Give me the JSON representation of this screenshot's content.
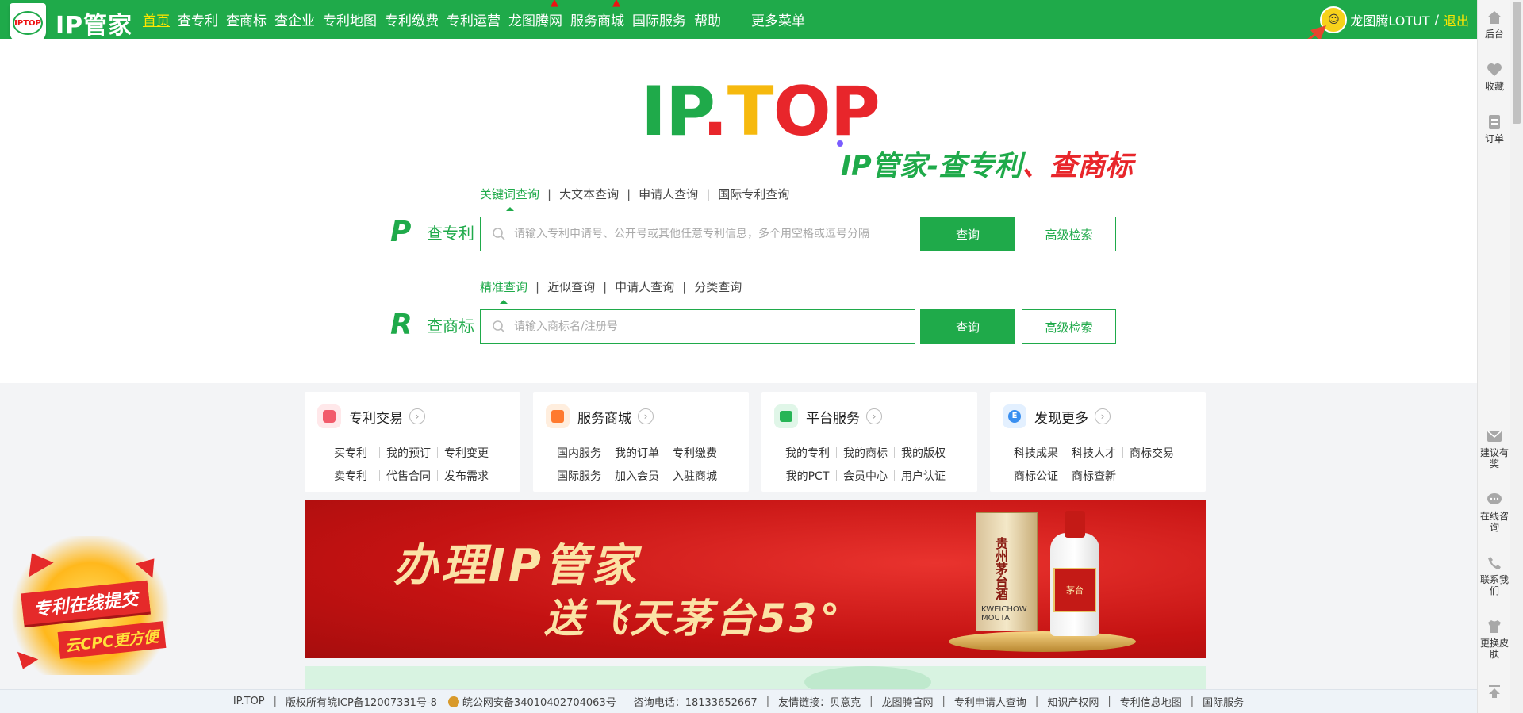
{
  "header": {
    "logo_text": "IPTOP",
    "brand": "IP管家",
    "nav": [
      {
        "label": "首页",
        "active": true
      },
      {
        "label": "查专利"
      },
      {
        "label": "查商标"
      },
      {
        "label": "查企业"
      },
      {
        "label": "专利地图"
      },
      {
        "label": "专利缴费"
      },
      {
        "label": "专利运营"
      },
      {
        "label": "龙图腾网",
        "hot": true
      },
      {
        "label": "服务商城",
        "hot": true
      },
      {
        "label": "国际服务"
      },
      {
        "label": "帮助"
      }
    ],
    "more_menu": "更多菜单",
    "username": "龙图腾LOTUT",
    "separator": "/",
    "logout": "退出"
  },
  "hero": {
    "logo_ip": "IP",
    "logo_dot": ".",
    "logo_t": "T",
    "logo_op": "OP",
    "slogan_main": "IP管家-查专利",
    "slogan_sep": "、",
    "slogan_red": "查商标"
  },
  "patent_search": {
    "tabs": [
      "关键词查询",
      "大文本查询",
      "申请人查询",
      "国际专利查询"
    ],
    "letter": "P",
    "label": "查专利",
    "placeholder": "请输入专利申请号、公开号或其他任意专利信息，多个用空格或逗号分隔",
    "search_button": "查询",
    "advanced_button": "高级检索"
  },
  "trademark_search": {
    "tabs": [
      "精准查询",
      "近似查询",
      "申请人查询",
      "分类查询"
    ],
    "letter": "R",
    "label": "查商标",
    "placeholder": "请输入商标名/注册号",
    "search_button": "查询",
    "advanced_button": "高级检索"
  },
  "cards": [
    {
      "title": "专利交易",
      "icon": "patent-trade-icon",
      "color": "#f25b6b",
      "bg": "#ffe8ea",
      "links": [
        [
          "买专利",
          "我的预订",
          "专利变更"
        ],
        [
          "卖专利",
          "代售合同",
          "发布需求"
        ]
      ]
    },
    {
      "title": "服务商城",
      "icon": "mall-icon",
      "color": "#ff7a2f",
      "bg": "#ffeede",
      "links": [
        [
          "国内服务",
          "我的订单",
          "专利缴费"
        ],
        [
          "国际服务",
          "加入会员",
          "入驻商城"
        ]
      ]
    },
    {
      "title": "平台服务",
      "icon": "platform-icon",
      "color": "#27b556",
      "bg": "#e0f6e8",
      "links": [
        [
          "我的专利",
          "我的商标",
          "我的版权"
        ],
        [
          "我的PCT",
          "会员中心",
          "用户认证"
        ]
      ]
    },
    {
      "title": "发现更多",
      "icon": "discover-icon",
      "color": "#3a8ff0",
      "bg": "#e3f0ff",
      "links": [
        [
          "科技成果",
          "科技人才",
          "商标交易"
        ],
        [
          "商标公证",
          "商标查新"
        ]
      ]
    }
  ],
  "banner": {
    "line1": "办理IP管家",
    "line2": "送飞天茅台53°",
    "box_text": "贵州茅台酒",
    "box_sub": "KWEICHOW MOUTAI"
  },
  "promo": {
    "line1": "专利在线提交",
    "line2": "云CPC更方便"
  },
  "footer": {
    "items": [
      "IP.TOP",
      "版权所有皖ICP备12007331号-8",
      "皖公网安备34010402704063号",
      "咨询电话：18133652667",
      "友情链接：贝意克",
      "龙图腾官网",
      "专利申请人查询",
      "知识产权网",
      "专利信息地图",
      "国际服务"
    ]
  },
  "sidebar": {
    "items": [
      {
        "label": "后台",
        "icon": "home-icon"
      },
      {
        "label": "收藏",
        "icon": "heart-icon"
      },
      {
        "label": "订单",
        "icon": "order-icon"
      },
      {
        "label": "建议有奖",
        "icon": "suggestion-icon"
      },
      {
        "label": "在线咨询",
        "icon": "chat-icon"
      },
      {
        "label": "联系我们",
        "icon": "phone-icon"
      },
      {
        "label": "更换皮肤",
        "icon": "shirt-icon"
      }
    ]
  },
  "colors": {
    "brand_green": "#1faa4a",
    "accent_red": "#e8262b",
    "accent_yellow": "#f6b90e",
    "nav_active": "#ffe600"
  }
}
